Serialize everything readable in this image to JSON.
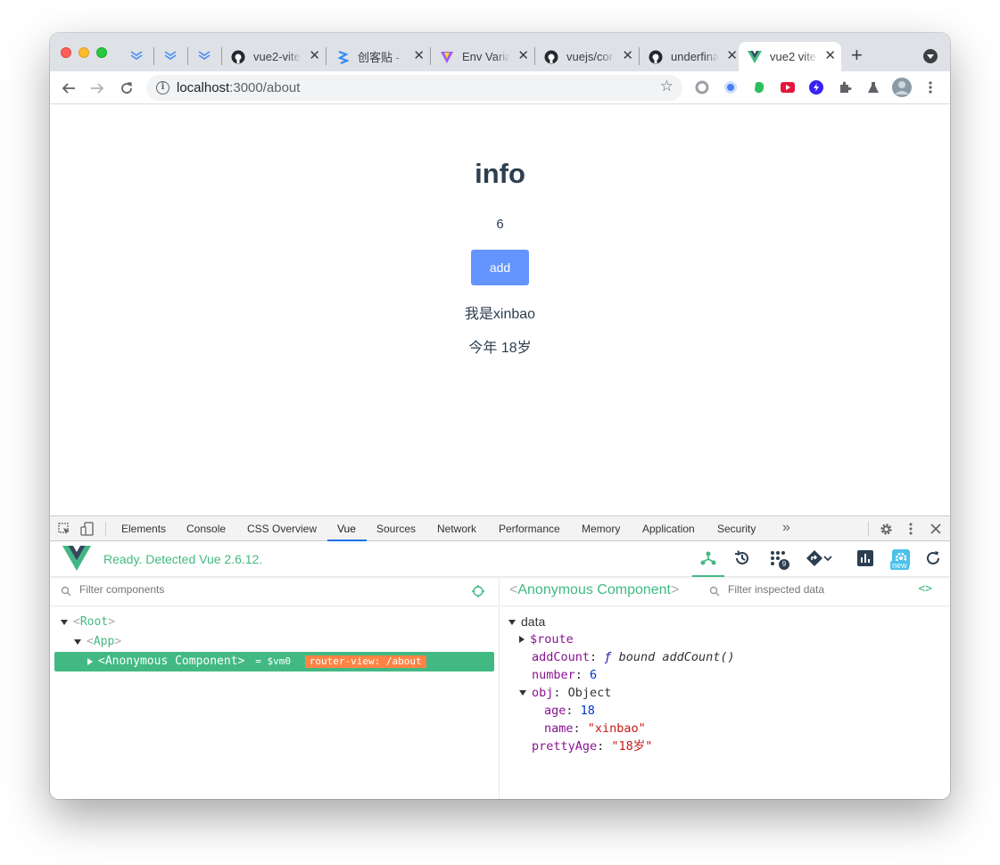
{
  "tabs": [
    {
      "title": "vue2-vite",
      "favicon": "github-icon"
    },
    {
      "title": "创客贴 - ",
      "favicon": "chuangkit-icon"
    },
    {
      "title": "Env Varia",
      "favicon": "vite-icon"
    },
    {
      "title": "vuejs/cor",
      "favicon": "github-icon"
    },
    {
      "title": "underfina",
      "favicon": "github-icon"
    },
    {
      "title": "vue2 vite",
      "favicon": "vue-icon",
      "active": true
    }
  ],
  "address": {
    "host": "localhost",
    "path": ":3000/about"
  },
  "page": {
    "heading": "info",
    "count": "6",
    "add_label": "add",
    "name_line": "我是xinbao",
    "age_line": "今年 18岁"
  },
  "devtools": {
    "tabs": [
      "Elements",
      "Console",
      "CSS Overview",
      "Vue",
      "Sources",
      "Network",
      "Performance",
      "Memory",
      "Application",
      "Security"
    ],
    "more": "»",
    "active_tab": "Vue",
    "vue_status": "Ready. Detected Vue 2.6.12.",
    "new_badge": "new",
    "events_count": "9",
    "filter_components_placeholder": "Filter components",
    "filter_data_placeholder": "Filter inspected data",
    "tree": {
      "root": "Root",
      "app": "App",
      "selected": "Anonymous Component",
      "vm": "= $vm0",
      "badge": "router-view: /about"
    },
    "inspector": {
      "title": "Anonymous Component",
      "section": "data",
      "route_key": "$route",
      "addCount_key": "addCount",
      "addCount_f": "ƒ",
      "addCount_val": "bound addCount()",
      "number_key": "number",
      "number_val": "6",
      "obj_key": "obj",
      "obj_val": "Object",
      "age_key": "age",
      "age_val": "18",
      "name_key": "name",
      "name_val": "\"xinbao\"",
      "prettyAge_key": "prettyAge",
      "prettyAge_val": "\"18岁\""
    }
  },
  "colors": {
    "vue_green": "#42b983",
    "button_blue": "#6495fe",
    "badge_orange": "#ff8344"
  }
}
